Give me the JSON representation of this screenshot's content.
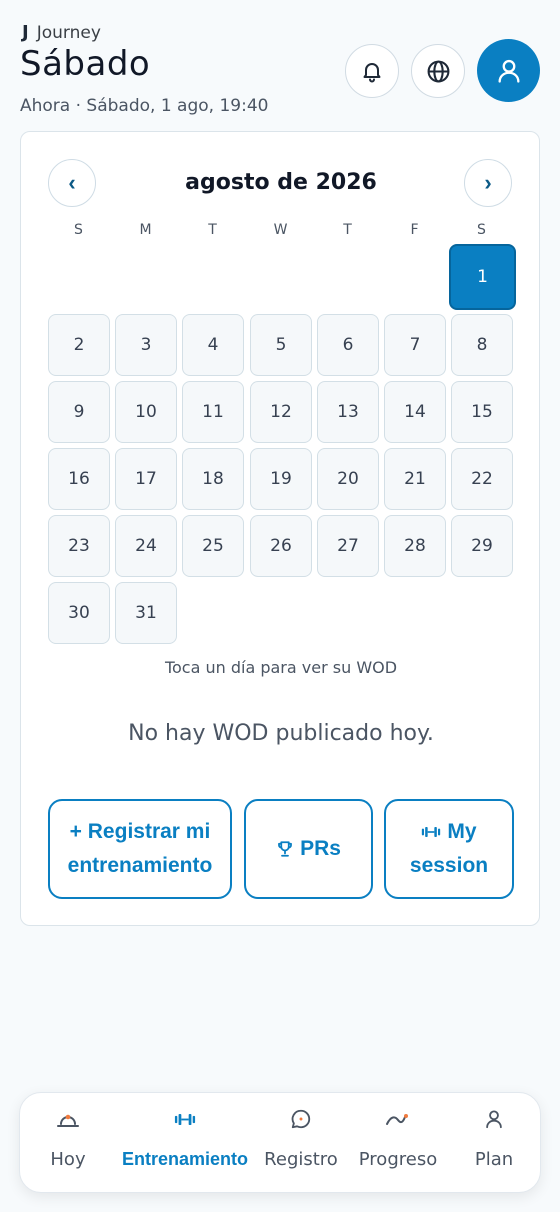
{
  "header": {
    "brand_mark": "J",
    "brand_name": "Journey",
    "title": "Sábado",
    "subtitle": "Ahora · Sábado, 1 ago, 19:40",
    "icons": [
      "bell-icon",
      "globe-icon",
      "user-icon"
    ]
  },
  "calendar": {
    "month_label": "agosto de 2026",
    "prev_glyph": "‹",
    "next_glyph": "›",
    "weekdays": [
      "S",
      "M",
      "T",
      "W",
      "T",
      "F",
      "S"
    ],
    "days": [
      "1",
      "2",
      "3",
      "4",
      "5",
      "6",
      "7",
      "8",
      "9",
      "10",
      "11",
      "12",
      "13",
      "14",
      "15",
      "16",
      "17",
      "18",
      "19",
      "20",
      "21",
      "22",
      "23",
      "24",
      "25",
      "26",
      "27",
      "28",
      "29",
      "30",
      "31"
    ],
    "selected_day": "1",
    "hint": "Toca un día para ver su WOD",
    "empty_message": "No hay WOD publicado hoy."
  },
  "actions": {
    "register": "+ Registrar mi entrenamiento",
    "prs": "PRs",
    "session": "My session"
  },
  "tabs": [
    {
      "label": "Hoy",
      "icon": "sunrise-icon",
      "active": false
    },
    {
      "label": "Entrenamiento",
      "icon": "dumbbell-icon",
      "active": true
    },
    {
      "label": "Registro",
      "icon": "chat-icon",
      "active": false
    },
    {
      "label": "Progreso",
      "icon": "trend-icon",
      "active": false
    },
    {
      "label": "Plan",
      "icon": "user-icon",
      "active": false
    }
  ],
  "colors": {
    "accent": "#0a7fc2",
    "background": "#f7fafc",
    "card": "#ffffff"
  }
}
